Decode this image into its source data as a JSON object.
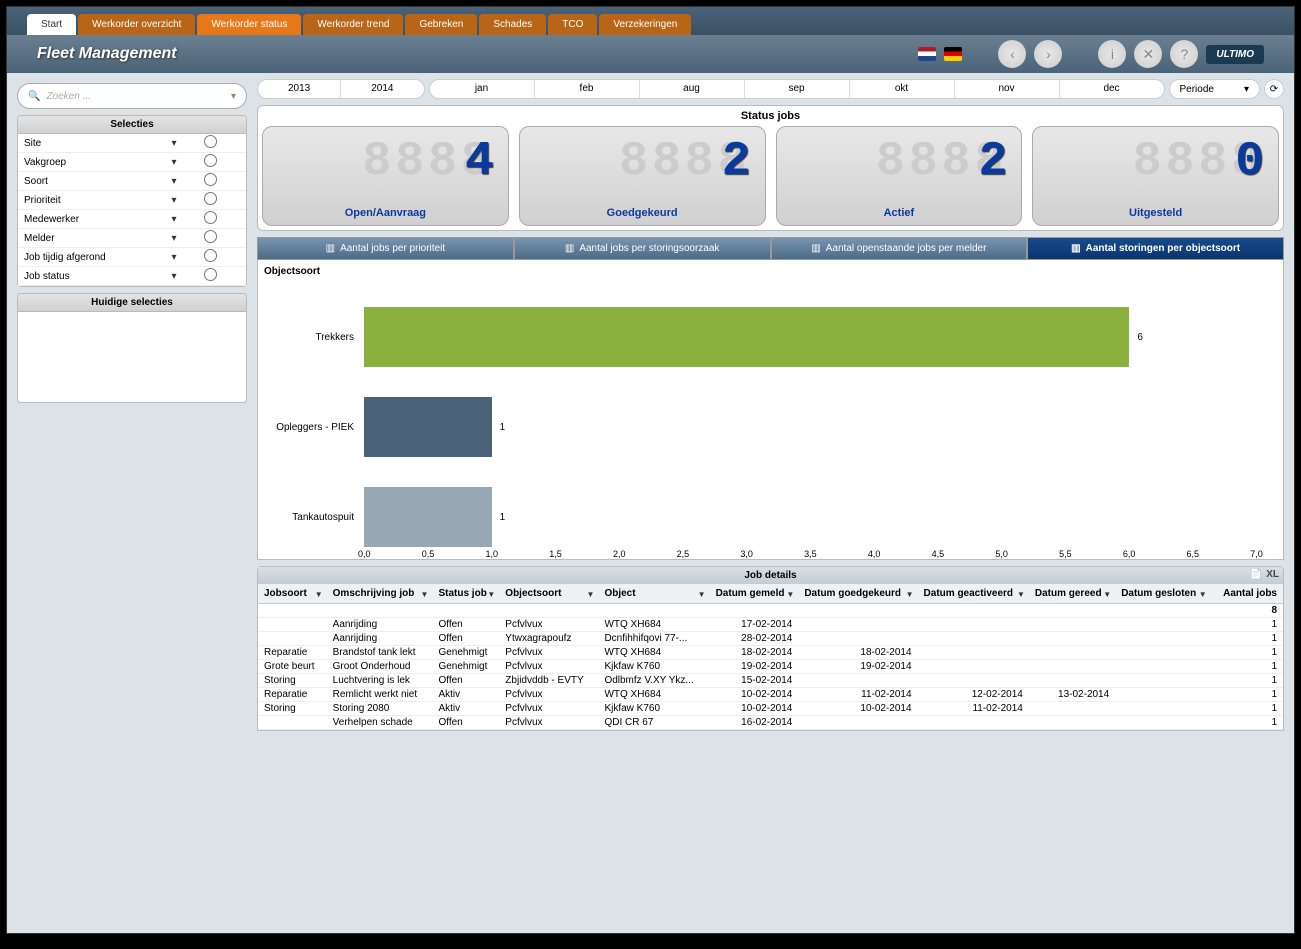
{
  "tabs": [
    "Start",
    "Werkorder overzicht",
    "Werkorder status",
    "Werkorder trend",
    "Gebreken",
    "Schades",
    "TCO",
    "Verzekeringen"
  ],
  "active_tab": 2,
  "header_title": "Fleet Management",
  "logo": "ULTIMO",
  "search_placeholder": "Zoeken ...",
  "selecties_title": "Selecties",
  "selecties": [
    "Site",
    "Vakgroep",
    "Soort",
    "Prioriteit",
    "Medewerker",
    "Melder",
    "Job tijdig afgerond",
    "Job status"
  ],
  "huidige_title": "Huidige selecties",
  "years": [
    "2013",
    "2014"
  ],
  "months": [
    "jan",
    "feb",
    "aug",
    "sep",
    "okt",
    "nov",
    "dec"
  ],
  "periode_label": "Periode",
  "status_title": "Status jobs",
  "counters": [
    {
      "label": "Open/Aanvraag",
      "value": "4"
    },
    {
      "label": "Goedgekeurd",
      "value": "2"
    },
    {
      "label": "Actief",
      "value": "2"
    },
    {
      "label": "Uitgesteld",
      "value": "0"
    }
  ],
  "chart_tabs": [
    "Aantal jobs per prioriteit",
    "Aantal jobs per storingsoorzaak",
    "Aantal openstaande jobs per melder",
    "Aantal storingen per objectsoort"
  ],
  "chart_label": "Objectsoort",
  "chart_data": {
    "type": "bar",
    "orientation": "horizontal",
    "categories": [
      "Trekkers",
      "Opleggers - PIEK",
      "Tankautospuit"
    ],
    "values": [
      6,
      1,
      1
    ],
    "colors": [
      "#8ab03e",
      "#4a6378",
      "#97a7b4"
    ],
    "xlim": [
      0.0,
      7.0
    ],
    "xticks": [
      "0,0",
      "0,5",
      "1,0",
      "1,5",
      "2,0",
      "2,5",
      "3,0",
      "3,5",
      "4,0",
      "4,5",
      "5,0",
      "5,5",
      "6,0",
      "6,5",
      "7,0"
    ]
  },
  "table_title": "Job details",
  "table_xl": "XL",
  "columns": [
    "Jobsoort",
    "Omschrijving job",
    "Status job",
    "Objectsoort",
    "Object",
    "Datum gemeld",
    "Datum goedgekeurd",
    "Datum geactiveerd",
    "Datum gereed",
    "Datum gesloten",
    "Aantal jobs"
  ],
  "total_row": {
    "aantal": "8"
  },
  "rows": [
    {
      "jobsoort": "",
      "omschrijving": "Aanrijding",
      "status": "Offen",
      "objectsoort": "Pcfvlvux",
      "object": "WTQ XH684",
      "gemeld": "17-02-2014",
      "goedgekeurd": "",
      "geactiveerd": "",
      "gereed": "",
      "gesloten": "",
      "aantal": "1"
    },
    {
      "jobsoort": "",
      "omschrijving": "Aanrijding",
      "status": "Offen",
      "objectsoort": "Ytwxagrapoufz",
      "object": "Dcnfihhifqovi 77-...",
      "gemeld": "28-02-2014",
      "goedgekeurd": "",
      "geactiveerd": "",
      "gereed": "",
      "gesloten": "",
      "aantal": "1"
    },
    {
      "jobsoort": "Reparatie",
      "omschrijving": "Brandstof tank lekt",
      "status": "Genehmigt",
      "objectsoort": "Pcfvlvux",
      "object": "WTQ XH684",
      "gemeld": "18-02-2014",
      "goedgekeurd": "18-02-2014",
      "geactiveerd": "",
      "gereed": "",
      "gesloten": "",
      "aantal": "1"
    },
    {
      "jobsoort": "Grote beurt",
      "omschrijving": "Groot Onderhoud",
      "status": "Genehmigt",
      "objectsoort": "Pcfvlvux",
      "object": "Kjkfaw K760",
      "gemeld": "19-02-2014",
      "goedgekeurd": "19-02-2014",
      "geactiveerd": "",
      "gereed": "",
      "gesloten": "",
      "aantal": "1"
    },
    {
      "jobsoort": "Storing",
      "omschrijving": "Luchtvering is lek",
      "status": "Offen",
      "objectsoort": "Zbjidvddb - EVTY",
      "object": "Odlbmfz V.XY Ykz...",
      "gemeld": "15-02-2014",
      "goedgekeurd": "",
      "geactiveerd": "",
      "gereed": "",
      "gesloten": "",
      "aantal": "1"
    },
    {
      "jobsoort": "Reparatie",
      "omschrijving": "Remlicht werkt niet",
      "status": "Aktiv",
      "objectsoort": "Pcfvlvux",
      "object": "WTQ XH684",
      "gemeld": "10-02-2014",
      "goedgekeurd": "11-02-2014",
      "geactiveerd": "12-02-2014",
      "gereed": "13-02-2014",
      "gesloten": "",
      "aantal": "1"
    },
    {
      "jobsoort": "Storing",
      "omschrijving": "Storing 2080",
      "status": "Aktiv",
      "objectsoort": "Pcfvlvux",
      "object": "Kjkfaw K760",
      "gemeld": "10-02-2014",
      "goedgekeurd": "10-02-2014",
      "geactiveerd": "11-02-2014",
      "gereed": "",
      "gesloten": "",
      "aantal": "1"
    },
    {
      "jobsoort": "",
      "omschrijving": "Verhelpen schade",
      "status": "Offen",
      "objectsoort": "Pcfvlvux",
      "object": "QDI CR 67",
      "gemeld": "16-02-2014",
      "goedgekeurd": "",
      "geactiveerd": "",
      "gereed": "",
      "gesloten": "",
      "aantal": "1"
    }
  ]
}
